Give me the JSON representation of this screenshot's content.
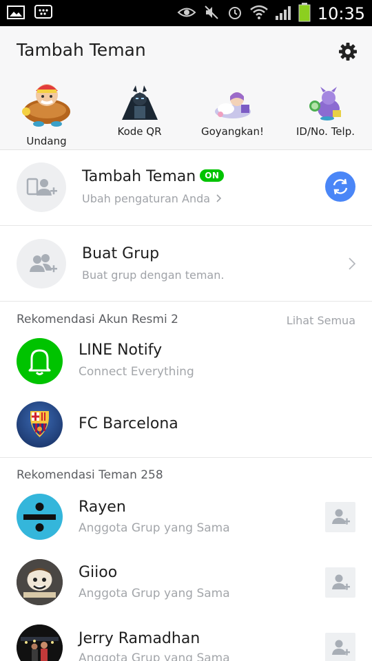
{
  "statusbar": {
    "time": "10:35"
  },
  "header": {
    "title": "Tambah Teman",
    "quick_actions": [
      {
        "label": "Undang"
      },
      {
        "label": "Kode QR"
      },
      {
        "label": "Goyangkan!"
      },
      {
        "label": "ID/No. Telp."
      }
    ]
  },
  "add_friend_row": {
    "title": "Tambah Teman",
    "badge": "ON",
    "subtitle": "Ubah pengaturan Anda"
  },
  "create_group_row": {
    "title": "Buat Grup",
    "subtitle": "Buat grup dengan teman."
  },
  "official": {
    "header": "Rekomendasi Akun Resmi 2",
    "see_all": "Lihat Semua",
    "items": [
      {
        "name": "LINE Notify",
        "subtitle": "Connect Everything"
      },
      {
        "name": "FC Barcelona"
      }
    ]
  },
  "friends": {
    "header": "Rekomendasi Teman 258",
    "items": [
      {
        "name": "Rayen",
        "subtitle": "Anggota Grup yang Sama"
      },
      {
        "name": "Giioo",
        "subtitle": "Anggota Grup yang Sama"
      },
      {
        "name": "Jerry Ramadhan",
        "subtitle": "Anggota Grup yang Sama"
      }
    ]
  },
  "colors": {
    "line_green": "#00c300",
    "sync_blue": "#4a86f7"
  }
}
